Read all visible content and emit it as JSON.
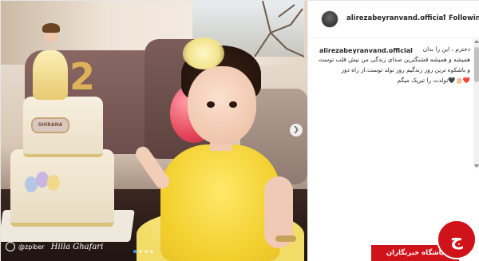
{
  "post": {
    "username": "alirezabeyranvand.official",
    "separator": "•",
    "follow_label": "Following"
  },
  "caption": {
    "username": "alirezabeyranvand.official",
    "lines": [
      "دخترم ، این را بدان",
      "همیشه و همیشه قشنگترین صدای زندگی من تپش قلب توست",
      "و باشکوه ترین روز زندگیم روز تولد توست.از راه دور",
      "❤️🎂🖤تولدت را تبریک میگم"
    ]
  },
  "photo": {
    "cake_plaque_text": "SHIRANA",
    "cake_number": "2",
    "watermark_handle": "@zpiber",
    "watermark_signature": "Hilla Ghafari",
    "carousel_dots": 4,
    "active_dot": 0,
    "next_icon": "chevron-right-icon"
  },
  "badge": {
    "text": "باشگاه خبرنگاران",
    "glyph": "ج"
  },
  "colors": {
    "badge_red": "#d0121b",
    "active_dot": "#3897f0",
    "text_dark": "#262626"
  }
}
